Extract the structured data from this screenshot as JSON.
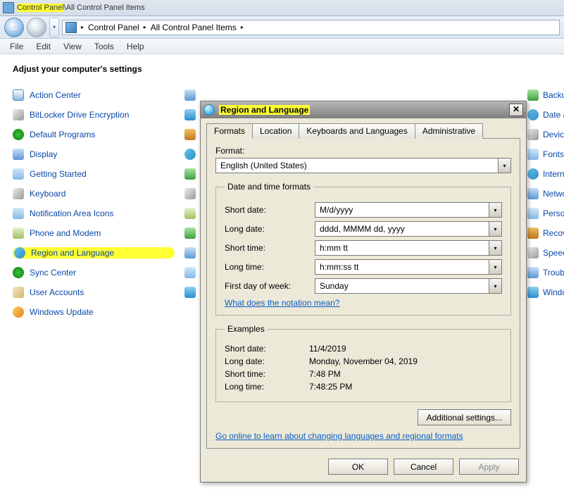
{
  "window": {
    "title_a": "Control Panel",
    "title_sep": "\\",
    "title_b": "All Control Panel Items"
  },
  "breadcrumb": {
    "a": "Control Panel",
    "b": "All Control Panel Items"
  },
  "menu": {
    "file": "File",
    "edit": "Edit",
    "view": "View",
    "tools": "Tools",
    "help": "Help"
  },
  "heading": "Adjust your computer's settings",
  "items_left": [
    "Action Center",
    "BitLocker Drive Encryption",
    "Default Programs",
    "Display",
    "Getting Started",
    "Keyboard",
    "Notification Area Icons",
    "Phone and Modem",
    "Region and Language",
    "Sync Center",
    "User Accounts",
    "Windows Update"
  ],
  "items_right": [
    "Backup and",
    "Date and",
    "Devices a",
    "Fonts",
    "Internet",
    "Network",
    "Personal",
    "Recovery",
    "Speech P",
    "Troubles",
    "Windows"
  ],
  "dialog": {
    "title": "Region and Language",
    "tabs": {
      "formats": "Formats",
      "location": "Location",
      "keyboards": "Keyboards and Languages",
      "admin": "Administrative"
    },
    "format_label": "Format:",
    "format_value": "English (United States)",
    "group_dt": "Date and time formats",
    "short_date_label": "Short date:",
    "short_date_value": "M/d/yyyy",
    "long_date_label": "Long date:",
    "long_date_value": "dddd, MMMM dd, yyyy",
    "short_time_label": "Short time:",
    "short_time_value": "h:mm tt",
    "long_time_label": "Long time:",
    "long_time_value": "h:mm:ss tt",
    "first_day_label": "First day of week:",
    "first_day_value": "Sunday",
    "notation_link": "What does the notation mean?",
    "group_ex": "Examples",
    "ex_short_date_k": "Short date:",
    "ex_short_date_v": "11/4/2019",
    "ex_long_date_k": "Long date:",
    "ex_long_date_v": "Monday, November 04, 2019",
    "ex_short_time_k": "Short time:",
    "ex_short_time_v": "7:48 PM",
    "ex_long_time_k": "Long time:",
    "ex_long_time_v": "7:48:25 PM",
    "additional": "Additional settings...",
    "online_link": "Go online to learn about changing languages and regional formats",
    "ok": "OK",
    "cancel": "Cancel",
    "apply": "Apply"
  }
}
